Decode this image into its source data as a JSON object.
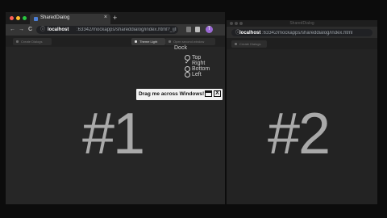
{
  "window1": {
    "tab_title": "SharedDialog",
    "tab_close": "×",
    "new_tab": "+",
    "nav": {
      "back": "←",
      "forward": "→",
      "reload": "C"
    },
    "url_host": "localhost",
    "url_path": ":63342/mockapps/shareddialog/index.html?_ijt=...",
    "avatar_letter": "T",
    "toolbar_buttons": {
      "left": "Create Dialogs",
      "theme": "Theme Light",
      "right": "Open second window"
    },
    "dock": {
      "label": "Dock",
      "options": [
        {
          "label": "Top",
          "selected": false
        },
        {
          "label": "Right",
          "selected": true
        },
        {
          "label": "Bottom",
          "selected": false
        },
        {
          "label": "Left",
          "selected": false
        }
      ]
    },
    "big_number": "#1",
    "dialog": {
      "text": "Drag me across Windows!",
      "close": "X"
    }
  },
  "window2": {
    "title": "SharedDialog",
    "url_host": "localhost",
    "url_path": ":63342/mockapps/shareddialog/index.html",
    "big_number": "#2",
    "toolbar_button": "Create Dialogs"
  },
  "colors": {
    "background": "#0c0c0c",
    "window": "#262626",
    "big_number": "#a9a9a9",
    "dialog": "#f2f2f2"
  }
}
